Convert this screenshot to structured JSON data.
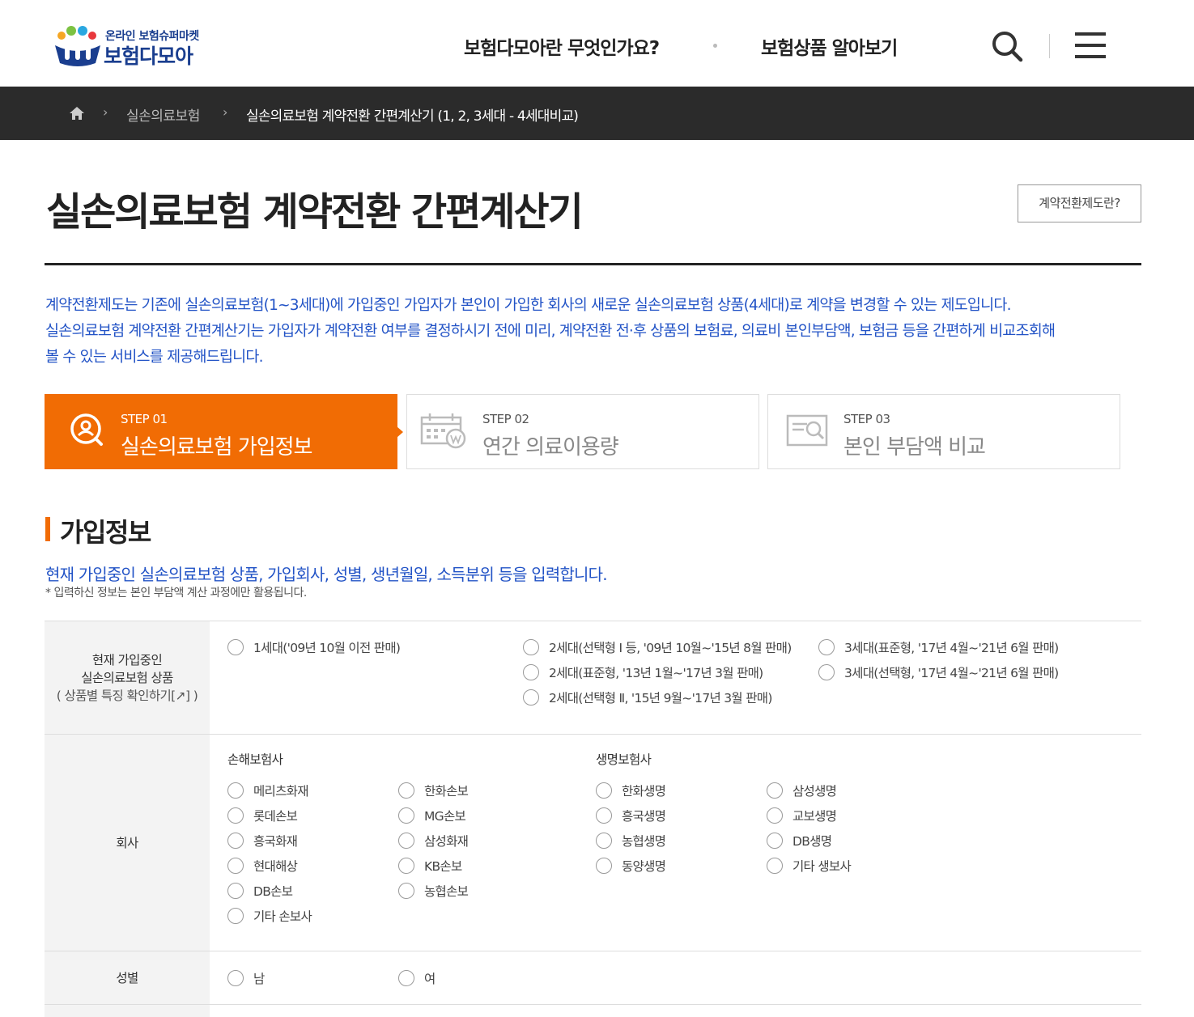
{
  "header": {
    "logo_sub": "온라인 보험슈퍼마켓",
    "logo_main": "보험다모아",
    "nav": [
      "보험다모아란 무엇인가요?",
      "보험상품 알아보기"
    ]
  },
  "breadcrumb": {
    "level1": "실손의료보험",
    "level2": "실손의료보험 계약전환 간편계산기 (1, 2, 3세대 - 4세대비교)"
  },
  "page": {
    "title": "실손의료보험 계약전환 간편계산기",
    "info_button": "계약전환제도란?",
    "description": [
      "계약전환제도는 기존에 실손의료보험(1~3세대)에 가입중인 가입자가 본인이 가입한 회사의 새로운 실손의료보험 상품(4세대)로 계약을 변경할 수 있는 제도입니다.",
      "실손의료보험 계약전환 간편계산기는 가입자가 계약전환 여부를 결정하시기 전에 미리, 계약전환 전·후 상품의 보험료, 의료비 본인부담액, 보험금 등을 간편하게 비교조회해",
      "볼 수 있는 서비스를 제공해드립니다."
    ]
  },
  "steps": [
    {
      "num": "STEP 01",
      "name": "실손의료보험 가입정보",
      "icon": "search-person-icon",
      "active": true
    },
    {
      "num": "STEP 02",
      "name": "연간 의료이용량",
      "icon": "calendar-won-icon",
      "active": false
    },
    {
      "num": "STEP 03",
      "name": "본인 부담액 비교",
      "icon": "document-search-icon",
      "active": false
    }
  ],
  "section": {
    "title": "가입정보",
    "description": "현재 가입중인 실손의료보험 상품, 가입회사, 성별, 생년월일, 소득분위 등을 입력합니다.",
    "note": "* 입력하신 정보는 본인 부담액 계산 과정에만 활용됩니다."
  },
  "form": {
    "product": {
      "label1": "현재 가입중인",
      "label2": "실손의료보험 상품",
      "link": "( 상품별 특징 확인하기[↗] )",
      "options": [
        "1세대('09년 10월 이전 판매)",
        "2세대(선택형 Ⅰ 등, '09년 10월~'15년 8월 판매)",
        "2세대(표준형, '13년 1월~'17년 3월 판매)",
        "2세대(선택형 Ⅱ, '15년 9월~'17년 3월 판매)",
        "3세대(표준형, '17년 4월~'21년 6월 판매)",
        "3세대(선택형, '17년 4월~'21년 6월 판매)"
      ]
    },
    "company": {
      "label": "회사",
      "nonlife_label": "손해보험사",
      "life_label": "생명보험사",
      "nonlife_col1": [
        "메리츠화재",
        "롯데손보",
        "흥국화재",
        "현대해상",
        "DB손보",
        "기타 손보사"
      ],
      "nonlife_col2": [
        "한화손보",
        "MG손보",
        "삼성화재",
        "KB손보",
        "농협손보"
      ],
      "life_col1": [
        "한화생명",
        "흥국생명",
        "농협생명",
        "동양생명"
      ],
      "life_col2": [
        "삼성생명",
        "교보생명",
        "DB생명",
        "기타 생보사"
      ]
    },
    "gender": {
      "label": "성별",
      "options": [
        "남",
        "여"
      ]
    }
  }
}
